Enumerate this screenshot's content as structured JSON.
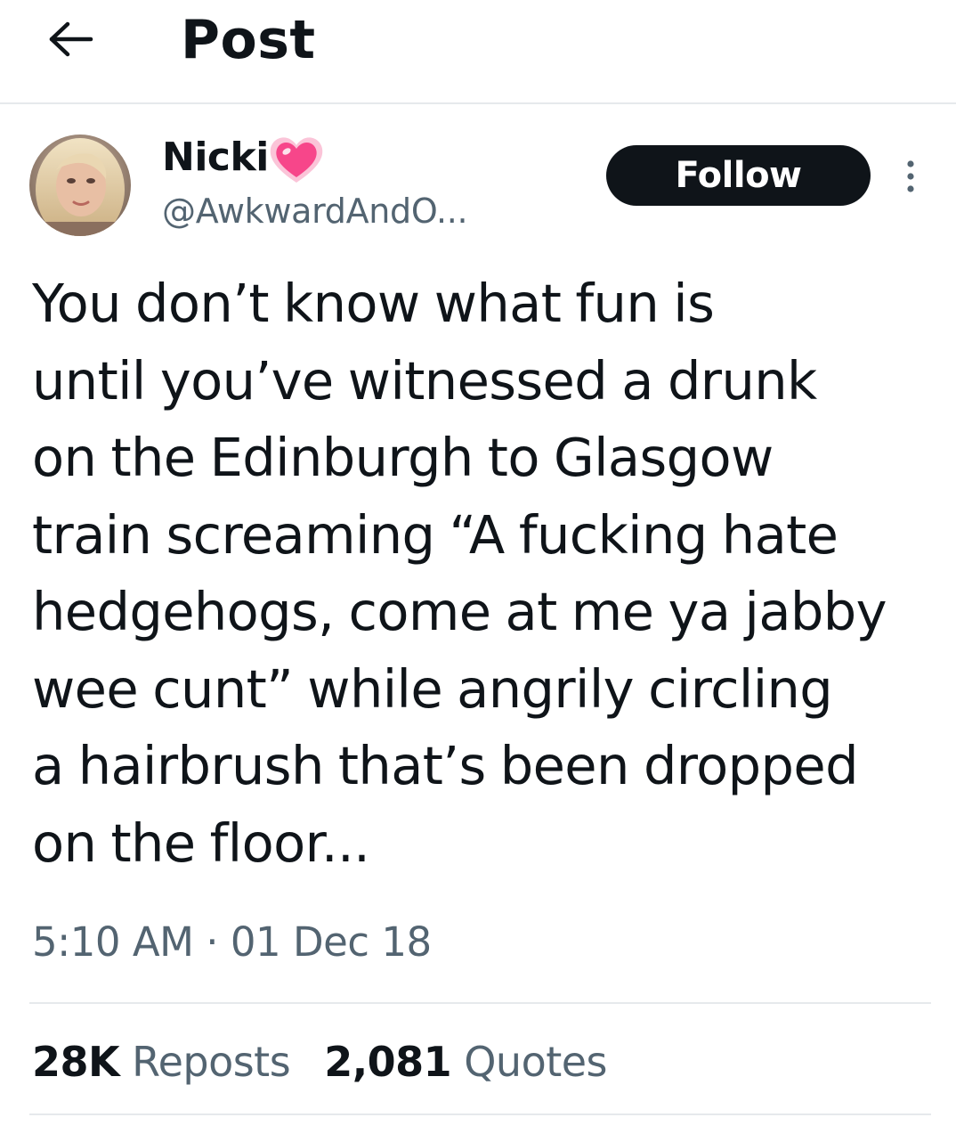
{
  "header": {
    "back_icon": "arrow-left-icon",
    "title": "Post"
  },
  "author": {
    "display_name": "Nicki",
    "name_emoji": "growing-heart-emoji",
    "handle": "@AwkwardAndO..."
  },
  "actions": {
    "follow_label": "Follow",
    "more_icon": "more-vertical-icon"
  },
  "tweet": {
    "text": "You don’t know what fun is\nuntil you’ve witnessed a drunk\non the Edinburgh to Glasgow\ntrain screaming “A fucking hate\nhedgehogs, come at me ya jabby\nwee cunt” while angrily circling\na hairbrush that’s been dropped\non the floor...",
    "timestamp": "5:10 AM · 01 Dec 18"
  },
  "stats": {
    "reposts_count": "28K",
    "reposts_label": "Reposts",
    "quotes_count": "2,081",
    "quotes_label": "Quotes"
  },
  "colors": {
    "text_primary": "#0f1419",
    "text_secondary": "#536471",
    "divider": "#e6e9ec",
    "follow_bg": "#0f1419",
    "heart": "#f7468a"
  }
}
